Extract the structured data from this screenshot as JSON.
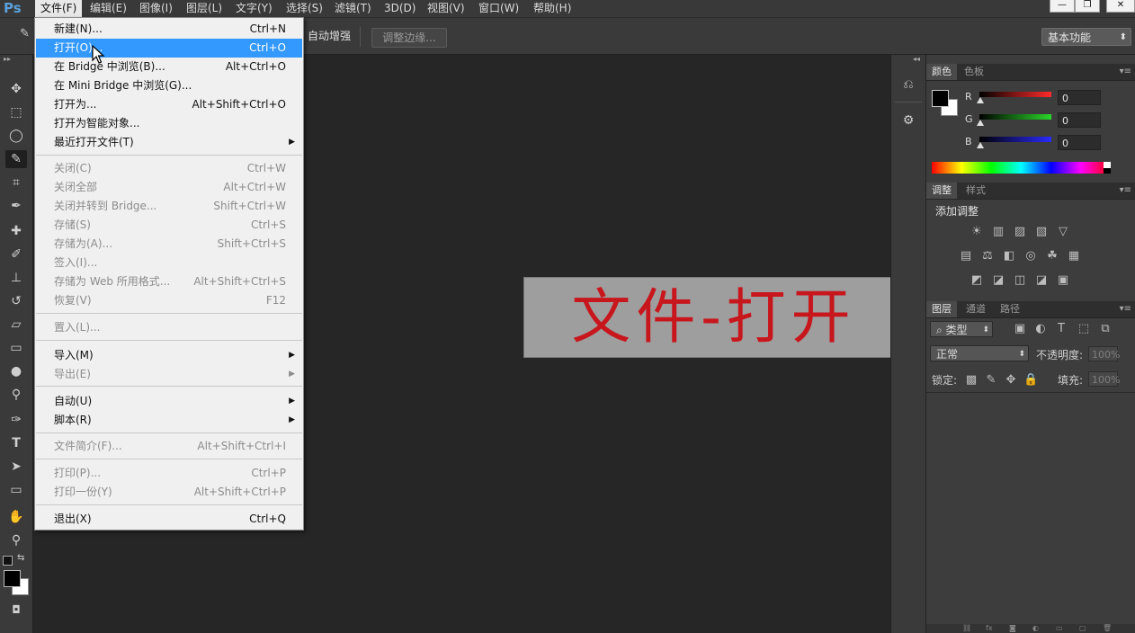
{
  "app": {
    "logo": "Ps"
  },
  "menubar": {
    "items": [
      "文件(F)",
      "编辑(E)",
      "图像(I)",
      "图层(L)",
      "文字(Y)",
      "选择(S)",
      "滤镜(T)",
      "3D(D)",
      "视图(V)",
      "窗口(W)",
      "帮助(H)"
    ],
    "active": "文件(F)"
  },
  "window_controls": {
    "minimize": "—",
    "restore": "❐",
    "close": "✕"
  },
  "options_bar": {
    "auto_enhance": "自动增强",
    "refine_edge": "调整边缘...",
    "workspace": "基本功能",
    "workspace_arrow": "⬍"
  },
  "file_menu": {
    "items": [
      {
        "label": "新建(N)...",
        "shortcut": "Ctrl+N",
        "enabled": true
      },
      {
        "label": "打开(O)...",
        "shortcut": "Ctrl+O",
        "enabled": true,
        "highlighted": true
      },
      {
        "label": "在 Bridge 中浏览(B)...",
        "shortcut": "Alt+Ctrl+O",
        "enabled": true
      },
      {
        "label": "在 Mini Bridge 中浏览(G)...",
        "shortcut": "",
        "enabled": true
      },
      {
        "label": "打开为...",
        "shortcut": "Alt+Shift+Ctrl+O",
        "enabled": true
      },
      {
        "label": "打开为智能对象...",
        "shortcut": "",
        "enabled": true
      },
      {
        "label": "最近打开文件(T)",
        "shortcut": "",
        "enabled": true,
        "submenu": true
      },
      {
        "label": "关闭(C)",
        "shortcut": "Ctrl+W",
        "enabled": false
      },
      {
        "label": "关闭全部",
        "shortcut": "Alt+Ctrl+W",
        "enabled": false
      },
      {
        "label": "关闭并转到 Bridge...",
        "shortcut": "Shift+Ctrl+W",
        "enabled": false
      },
      {
        "label": "存储(S)",
        "shortcut": "Ctrl+S",
        "enabled": false
      },
      {
        "label": "存储为(A)...",
        "shortcut": "Shift+Ctrl+S",
        "enabled": false
      },
      {
        "label": "签入(I)...",
        "shortcut": "",
        "enabled": false
      },
      {
        "label": "存储为 Web 所用格式...",
        "shortcut": "Alt+Shift+Ctrl+S",
        "enabled": false
      },
      {
        "label": "恢复(V)",
        "shortcut": "F12",
        "enabled": false
      },
      {
        "label": "置入(L)...",
        "shortcut": "",
        "enabled": false
      },
      {
        "label": "导入(M)",
        "shortcut": "",
        "enabled": true,
        "submenu": true
      },
      {
        "label": "导出(E)",
        "shortcut": "",
        "enabled": false,
        "submenu": true
      },
      {
        "label": "自动(U)",
        "shortcut": "",
        "enabled": true,
        "submenu": true
      },
      {
        "label": "脚本(R)",
        "shortcut": "",
        "enabled": true,
        "submenu": true
      },
      {
        "label": "文件简介(F)...",
        "shortcut": "Alt+Shift+Ctrl+I",
        "enabled": false
      },
      {
        "label": "打印(P)...",
        "shortcut": "Ctrl+P",
        "enabled": false
      },
      {
        "label": "打印一份(Y)",
        "shortcut": "Alt+Shift+Ctrl+P",
        "enabled": false
      },
      {
        "label": "退出(X)",
        "shortcut": "Ctrl+Q",
        "enabled": true
      }
    ],
    "submenu_arrow": "▶"
  },
  "document": {
    "text": "文件-打开"
  },
  "tools": {
    "move": "✥",
    "marquee": "⬚",
    "lasso": "◯",
    "quick_select": "✎",
    "crop": "⌗",
    "eyedropper": "✒",
    "healing": "✚",
    "brush": "✐",
    "stamp": "⊥",
    "history_brush": "↺",
    "eraser": "▱",
    "gradient": "▭",
    "blur": "●",
    "dodge": "⚲",
    "pen": "✑",
    "type": "T",
    "path_select": "➤",
    "shape": "▭",
    "hand": "✋",
    "zoom": "⚲",
    "quickmask": "◘",
    "collapse": "▸▸"
  },
  "dock": {
    "collapse": "◂◂",
    "history": "⎌",
    "properties": "⚙"
  },
  "color_panel": {
    "tabs": [
      "颜色",
      "色板"
    ],
    "active_tab": "颜色",
    "channels": [
      {
        "label": "R",
        "value": "0",
        "color": "#ff2a2a"
      },
      {
        "label": "G",
        "value": "0",
        "color": "#2ad62a"
      },
      {
        "label": "B",
        "value": "0",
        "color": "#2a2aff"
      }
    ]
  },
  "adjustments_panel": {
    "tabs": [
      "调整",
      "样式"
    ],
    "active_tab": "调整",
    "title": "添加调整",
    "icons_row1": [
      "☀",
      "▥",
      "▨",
      "▧",
      "▽"
    ],
    "icons_row2": [
      "▤",
      "⚖",
      "◧",
      "◎",
      "☘",
      "▦"
    ],
    "icons_row3": [
      "◩",
      "◪",
      "◫",
      "◪",
      "▣"
    ]
  },
  "layers_panel": {
    "tabs": [
      "图层",
      "通道",
      "路径"
    ],
    "active_tab": "图层",
    "filter": "⌕ 类型",
    "filter_arrow": "⬍",
    "filter_icons": [
      "▣",
      "◐",
      "T",
      "⬚",
      "⧉"
    ],
    "blend_mode": "正常",
    "opacity_label": "不透明度:",
    "opacity_value": "100%",
    "lock_label": "锁定:",
    "lock_icons": [
      "▩",
      "✎",
      "✥",
      "🔒"
    ],
    "fill_label": "填充:",
    "fill_value": "100%",
    "footer_icons": [
      "⛓",
      "fx",
      "◙",
      "◐",
      "▭",
      "▢",
      "🗑"
    ]
  },
  "panel_menu_icon": "▾≡"
}
